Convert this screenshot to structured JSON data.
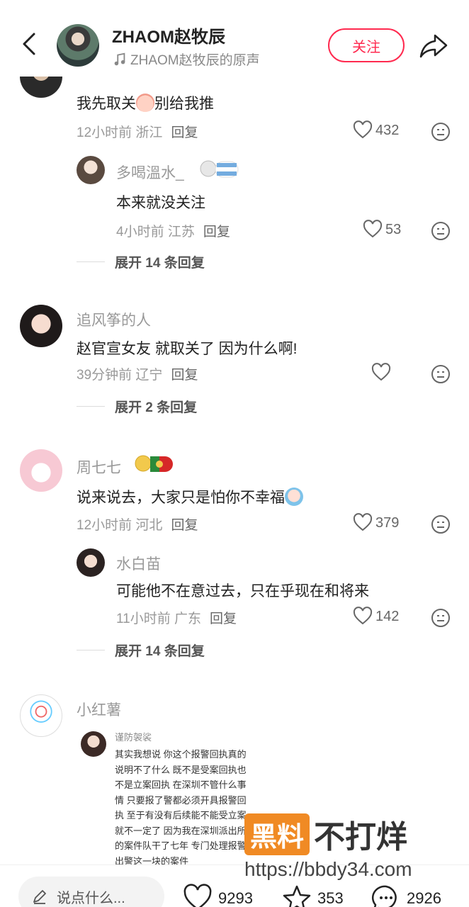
{
  "header": {
    "title": "ZHAOM赵牧辰",
    "subtitle": "ZHAOM赵牧辰的原声",
    "follow_label": "关注"
  },
  "comments": [
    {
      "text": "我先取关",
      "text_after": "别给我推",
      "time": "12小时前",
      "location": "浙江",
      "reply_label": "回复",
      "likes": "432",
      "replies": [
        {
          "name": "多喝溫水_",
          "text": "本来就没关注",
          "time": "4小时前",
          "location": "江苏",
          "reply_label": "回复",
          "likes": "53"
        }
      ],
      "expand_label": "展开 14 条回复"
    },
    {
      "name": "追风筝的人",
      "text": "赵官宣女友 就取关了 因为什么啊!",
      "time": "39分钟前",
      "location": "辽宁",
      "reply_label": "回复",
      "likes": "",
      "expand_label": "展开 2 条回复"
    },
    {
      "name": "周七七",
      "text": "说来说去，大家只是怕你不幸福",
      "time": "12小时前",
      "location": "河北",
      "reply_label": "回复",
      "likes": "379",
      "replies": [
        {
          "name": "水白苗",
          "text": "可能他不在意过去，只在乎现在和将来",
          "time": "11小时前",
          "location": "广东",
          "reply_label": "回复",
          "likes": "142"
        }
      ],
      "expand_label": "展开 14 条回复"
    },
    {
      "name": "小红薯",
      "repost": {
        "name": "谨防袈裟",
        "lines": [
          "其实我想说 你这个报警回执真的",
          "说明不了什么 既不是受案回执也",
          "不是立案回执 在深圳不管什么事",
          "情 只要报了警都必须开具报警回",
          "执 至于有没有后续能不能受立案",
          "就不一定了 因为我在深圳派出所",
          "的案件队干了七年 专门处理报警",
          "出警这一块的案件"
        ]
      }
    }
  ],
  "watermark": {
    "box": "黑料",
    "text": "不打烊",
    "url": "https://bbdy34.com"
  },
  "bottom_bar": {
    "input_placeholder": "说点什么...",
    "likes": "9293",
    "favorites": "353",
    "comments": "2926"
  },
  "colors": {
    "accent": "#ff2a4f",
    "watermark": "#f08a24"
  }
}
